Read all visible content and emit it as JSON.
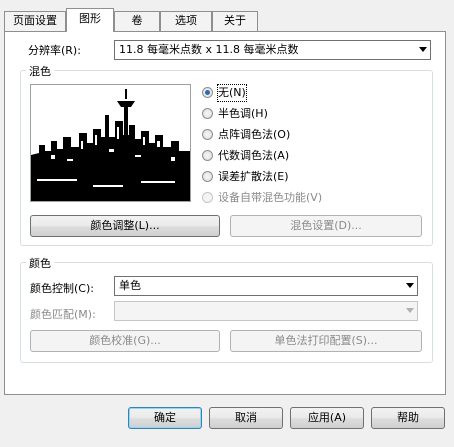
{
  "tabs": [
    {
      "label": "页面设置",
      "active": false
    },
    {
      "label": "图形",
      "active": true
    },
    {
      "label": "卷",
      "active": false
    },
    {
      "label": "选项",
      "active": false
    },
    {
      "label": "关于",
      "active": false
    }
  ],
  "resolution": {
    "label": "分辨率(R):",
    "value": "11.8 每毫米点数 x 11.8 每毫米点数"
  },
  "dither": {
    "group_title": "混色",
    "options": [
      {
        "label": "无(N)",
        "checked": true,
        "enabled": true
      },
      {
        "label": "半色调(H)",
        "checked": false,
        "enabled": true
      },
      {
        "label": "点阵调色法(O)",
        "checked": false,
        "enabled": true
      },
      {
        "label": "代数调色法(A)",
        "checked": false,
        "enabled": true
      },
      {
        "label": "误差扩散法(E)",
        "checked": false,
        "enabled": true
      },
      {
        "label": "设备自带混色功能(V)",
        "checked": false,
        "enabled": false
      }
    ],
    "color_adjust_button": "颜色调整(L)...",
    "dither_settings_button": "混色设置(D)..."
  },
  "color": {
    "group_title": "颜色",
    "control_label": "颜色控制(C):",
    "control_value": "单色",
    "match_label": "颜色匹配(M):",
    "match_value": "",
    "calibrate_button": "颜色校准(G)...",
    "mono_print_button": "单色法打印配置(S)..."
  },
  "footer": {
    "ok": "确定",
    "cancel": "取消",
    "apply": "应用(A)",
    "help": "帮助"
  },
  "colors": {
    "accent": "#2a6bb5",
    "border": "#8e8f8f",
    "disabled": "#8a8a8a"
  }
}
